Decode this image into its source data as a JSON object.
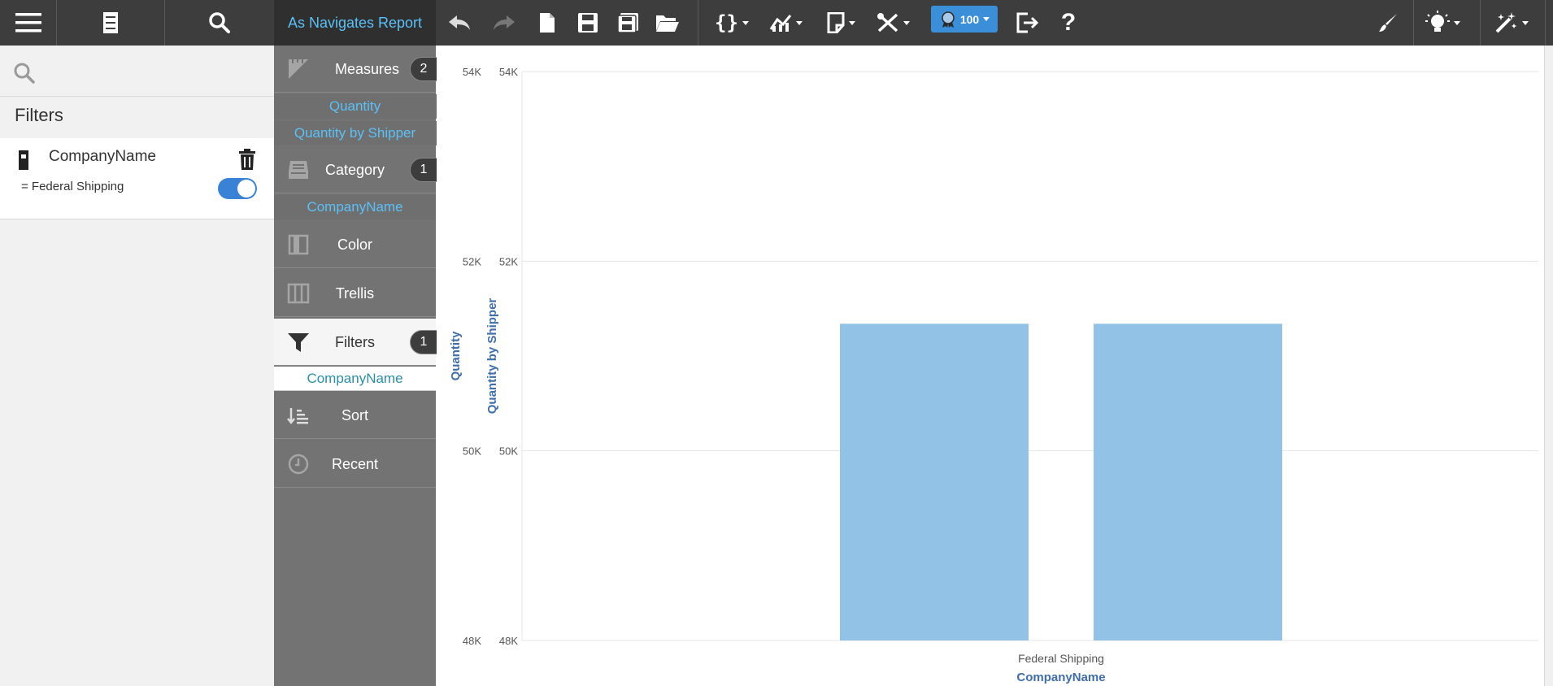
{
  "toolbar": {
    "report_title": "As Navigates Report",
    "score_badge": "100",
    "icons": [
      "hamburger-menu-icon",
      "data-cabinet-icon",
      "search-icon",
      "undo-icon",
      "redo-icon",
      "new-file-icon",
      "save-icon",
      "save-as-icon",
      "open-folder-icon",
      "variables-icon",
      "chart-type-icon",
      "notes-icon",
      "tools-icon",
      "award-icon",
      "exit-icon",
      "help-icon",
      "brush-icon",
      "lightbulb-icon",
      "magic-wand-icon"
    ],
    "accent_color": "#3a8fd8"
  },
  "filters_panel": {
    "search_placeholder": "",
    "title": "Filters",
    "filter": {
      "name": "CompanyName",
      "condition": "= Federal Shipping",
      "enabled": true
    }
  },
  "shelf": {
    "measures": {
      "label": "Measures",
      "count": "2",
      "items": [
        "Quantity",
        "Quantity by Shipper"
      ]
    },
    "category": {
      "label": "Category",
      "count": "1",
      "items": [
        "CompanyName"
      ]
    },
    "color": {
      "label": "Color"
    },
    "trellis": {
      "label": "Trellis"
    },
    "filters": {
      "label": "Filters",
      "count": "1",
      "items": [
        "CompanyName"
      ]
    },
    "sort": {
      "label": "Sort"
    },
    "recent": {
      "label": "Recent"
    }
  },
  "chart_data": {
    "type": "bar",
    "categories": [
      "Federal Shipping"
    ],
    "series": [
      {
        "name": "Quantity",
        "values": [
          51340
        ],
        "color": "#92c3e6"
      },
      {
        "name": "Quantity by Shipper",
        "values": [
          51340
        ],
        "color": "#92c3e6"
      }
    ],
    "xlabel": "CompanyName",
    "ylabel_left": "Quantity",
    "ylabel_right": "Quantity by Shipper",
    "ylim": [
      48000,
      54000
    ],
    "yticks": [
      {
        "value": 48000,
        "label": "48K"
      },
      {
        "value": 50000,
        "label": "50K"
      },
      {
        "value": 52000,
        "label": "52K"
      },
      {
        "value": 54000,
        "label": "54K"
      }
    ],
    "grid": true
  }
}
